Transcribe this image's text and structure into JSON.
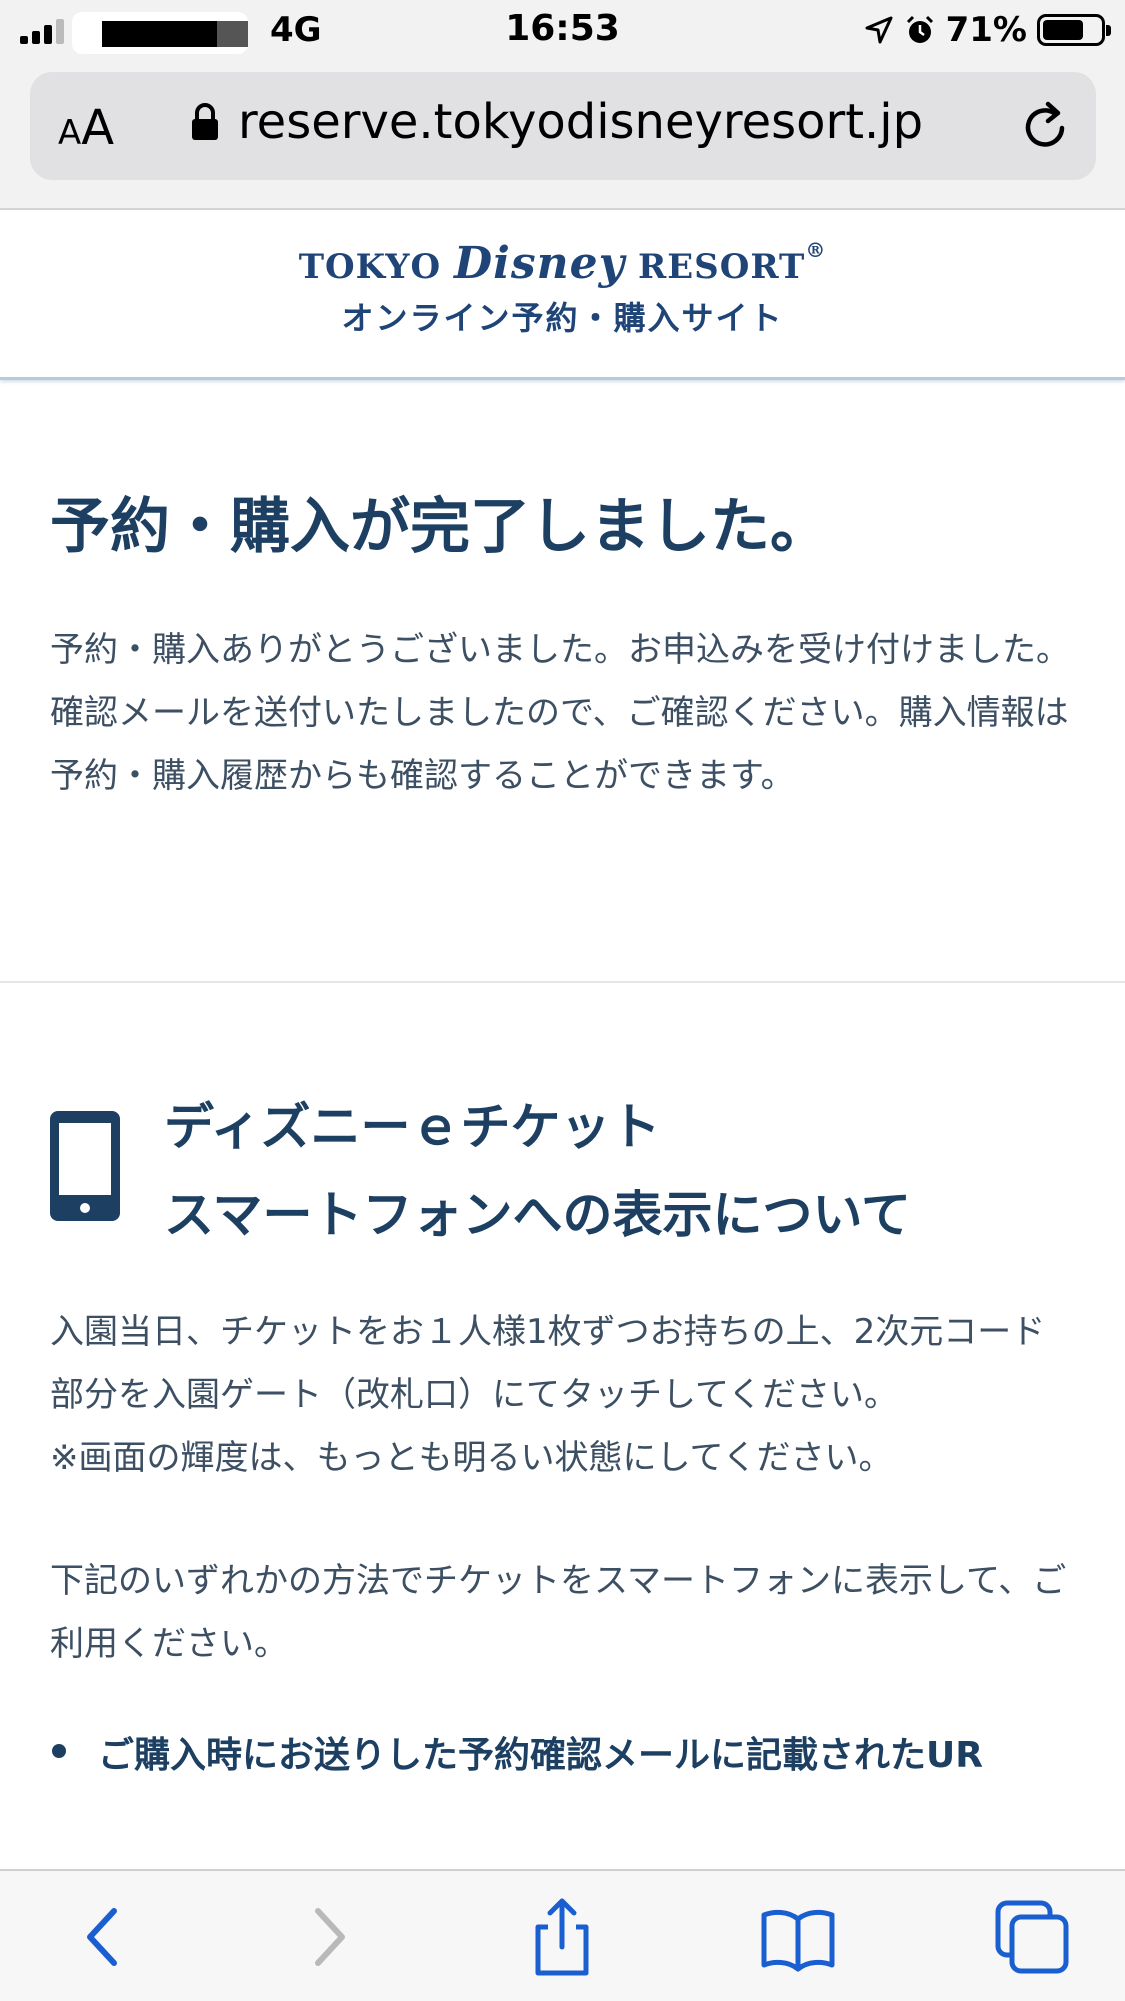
{
  "status_bar": {
    "network": "4G",
    "time": "16:53",
    "battery_percent": "71%",
    "battery_level": 0.71
  },
  "address_bar": {
    "aa_small": "A",
    "aa_large": "A",
    "url": "reserve.tokyodisneyresort.jp"
  },
  "site_header": {
    "logo_line1_pre": "TOKYO ",
    "logo_line1_script": "Disney",
    "logo_line1_post": " RESORT",
    "logo_reg": "®",
    "logo_line2": "オンライン予約・購入サイト"
  },
  "completion": {
    "title": "予約・購入が完了しました。",
    "body": "予約・購入ありがとうございました。お申込みを受け付けました。確認メールを送付いたしましたので、ご確認ください。購入情報は予約・購入履歴からも確認することができます。"
  },
  "eticket": {
    "title_line1": "ディズニーｅチケット",
    "title_line2": "スマートフォンへの表示について",
    "para1": "入園当日、チケットをお１人様1枚ずつお持ちの上、2次元コード部分を入園ゲート（改札口）にてタッチしてください。",
    "para2": "※画面の輝度は、もっとも明るい状態にしてください。",
    "para3": "下記のいずれかの方法でチケットをスマートフォンに表示して、ご利用ください。",
    "bullets": [
      "ご購入時にお送りした予約確認メールに記載されたUR"
    ]
  },
  "colors": {
    "brand_navy": "#1c3f62",
    "toolbar_blue": "#1a5fd0",
    "toolbar_disabled": "#b9b9b9"
  }
}
